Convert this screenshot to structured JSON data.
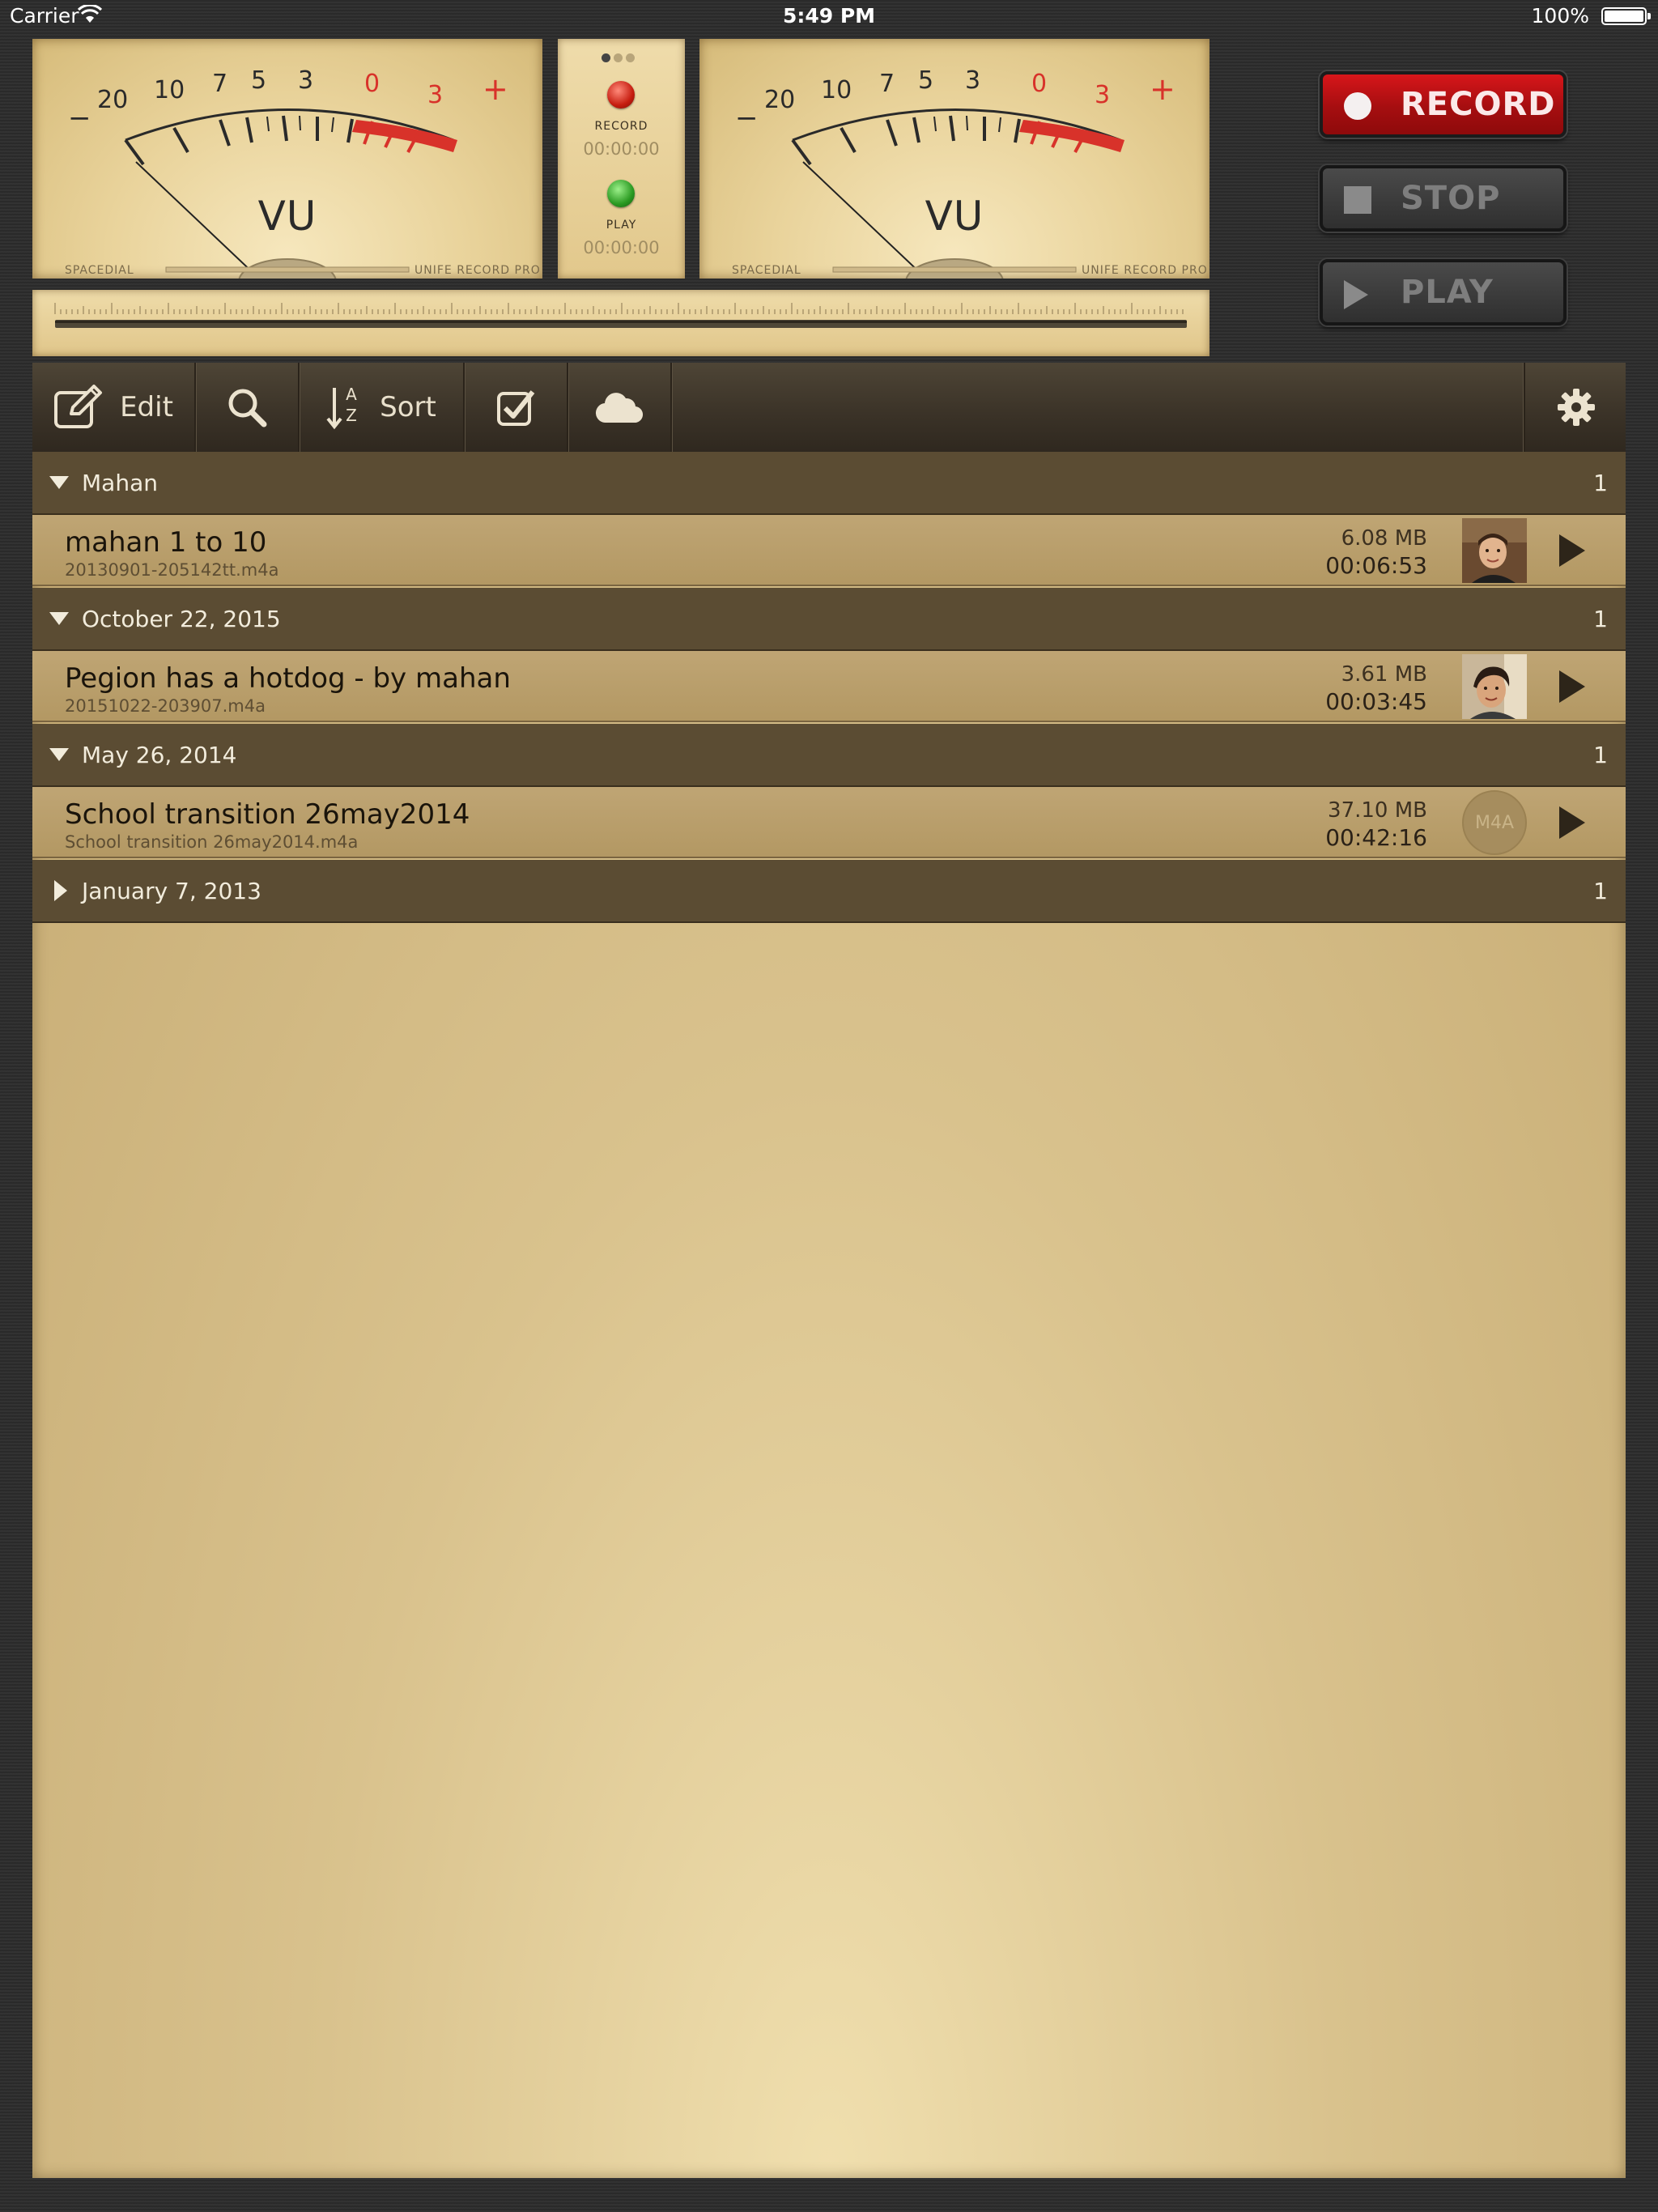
{
  "status_bar": {
    "carrier": "Carrier",
    "time": "5:49 PM",
    "battery": "100%"
  },
  "vu_meters": {
    "label": "VU",
    "scale_labels": [
      "−",
      "20",
      "10",
      "7",
      "5",
      "3",
      "0",
      "3",
      "+"
    ],
    "bottom_left_text": "SPACEDIAL",
    "bottom_right_text": "UNIFE RECORD PRO"
  },
  "center_panel": {
    "record_label": "RECORD",
    "record_time": "00:00:00",
    "play_label": "PLAY",
    "play_time": "00:00:00"
  },
  "transport": {
    "record": "RECORD",
    "stop": "STOP",
    "play": "PLAY"
  },
  "toolbar": {
    "edit": "Edit",
    "sort": "Sort",
    "sort_icon_top": "A",
    "sort_icon_bottom": "Z"
  },
  "sections": [
    {
      "title": "Mahan",
      "count": "1",
      "expanded": true,
      "rows": [
        {
          "title": "mahan 1 to 10",
          "file": "20130901-205142tt.m4a",
          "size": "6.08 MB",
          "duration": "00:06:53",
          "thumb": "photo"
        }
      ]
    },
    {
      "title": "October 22, 2015",
      "count": "1",
      "expanded": true,
      "rows": [
        {
          "title": "Pegion has a hotdog - by mahan",
          "file": "20151022-203907.m4a",
          "size": "3.61 MB",
          "duration": "00:03:45",
          "thumb": "photo"
        }
      ]
    },
    {
      "title": "May 26, 2014",
      "count": "1",
      "expanded": true,
      "rows": [
        {
          "title": "School transition 26may2014",
          "file": "School transition 26may2014.m4a",
          "size": "37.10 MB",
          "duration": "00:42:16",
          "thumb": "m4a",
          "badge": "M4A"
        }
      ]
    },
    {
      "title": "January 7, 2013",
      "count": "1",
      "expanded": false,
      "rows": []
    }
  ],
  "colors": {
    "record_red": "#c8131a",
    "vu_red": "#d8322a",
    "header_brown": "#5b4c33",
    "row_tan": "#b9a06c"
  },
  "icons": [
    "wifi-icon",
    "battery-icon",
    "edit-icon",
    "search-icon",
    "sort-icon",
    "checkbox-icon",
    "cloud-icon",
    "gear-icon",
    "play-icon",
    "record-dot-icon",
    "stop-square-icon"
  ]
}
